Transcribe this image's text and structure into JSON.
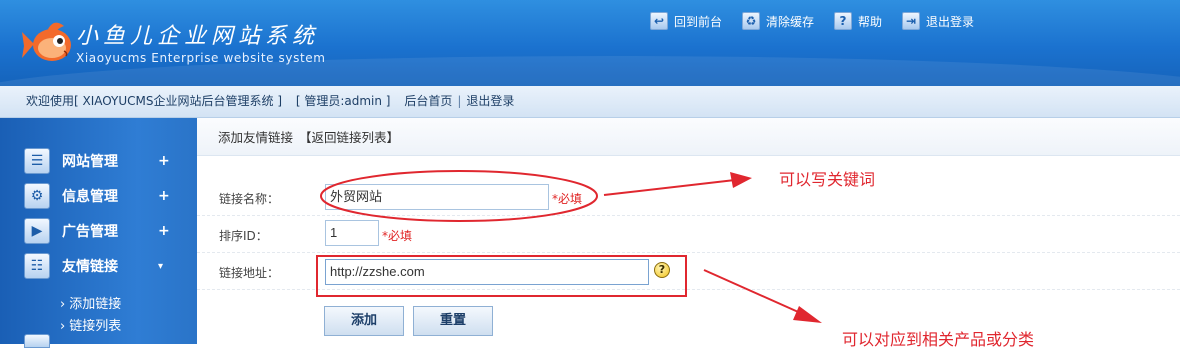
{
  "header": {
    "title": "小鱼儿企业网站系统",
    "subtitle": "Xiaoyucms Enterprise website system",
    "nav": [
      {
        "label": "回到前台",
        "icon": "home-arrow-icon"
      },
      {
        "label": "清除缓存",
        "icon": "trash-icon"
      },
      {
        "label": "帮助",
        "icon": "help-icon"
      },
      {
        "label": "退出登录",
        "icon": "logout-icon"
      }
    ]
  },
  "infobar": {
    "welcome": "欢迎使用[ XIAOYUCMS企业网站后台管理系统 ]",
    "admin": "[ 管理员:admin ]",
    "home_link": "后台首页",
    "separator": "|",
    "logout_link": "退出登录"
  },
  "sidebar": {
    "items": [
      {
        "label": "网站管理",
        "sign": "+",
        "icon": "list-icon"
      },
      {
        "label": "信息管理",
        "sign": "+",
        "icon": "gear-icon"
      },
      {
        "label": "广告管理",
        "sign": "+",
        "icon": "play-icon"
      },
      {
        "label": "友情链接",
        "sign": "▾",
        "icon": "sliders-icon"
      }
    ],
    "subitems": [
      {
        "label": "添加链接"
      },
      {
        "label": "链接列表"
      }
    ]
  },
  "main": {
    "breadcrumb": "添加友情链接",
    "back_link": "【返回链接列表】",
    "form": {
      "name_label": "链接名称：",
      "name_value": "外贸网站",
      "order_label": "排序ID：",
      "order_value": "1",
      "url_label": "链接地址：",
      "url_value": "http://zzshe.com",
      "required": "*必填",
      "help_glyph": "?"
    },
    "buttons": {
      "add": "添加",
      "reset": "重置"
    }
  },
  "annotations": {
    "note1": "可以写关键词",
    "note2": "可以对应到相关产品或分类"
  },
  "colors": {
    "header_blue": "#1b72cf",
    "sidebar_blue": "#2f7dd4",
    "annotation_red": "#e0272f"
  }
}
